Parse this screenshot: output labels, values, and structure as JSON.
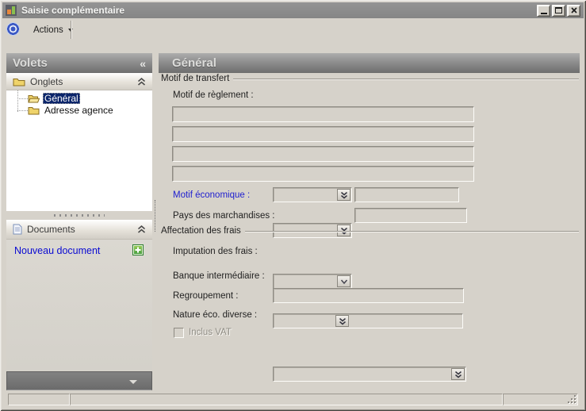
{
  "window": {
    "title": "Saisie complémentaire"
  },
  "toolbar": {
    "actions_label": "Actions"
  },
  "sidebar": {
    "header": "Volets",
    "collapse_glyph": "«",
    "onglets": {
      "label": "Onglets",
      "items": [
        {
          "label": "Général",
          "selected": true
        },
        {
          "label": "Adresse agence",
          "selected": false
        }
      ]
    },
    "documents": {
      "label": "Documents",
      "new_document_label": "Nouveau document"
    }
  },
  "main": {
    "header": "Général",
    "transfer_group": {
      "title": "Motif de transfert",
      "motif_reglement_label": "Motif de règlement :",
      "motif_values": [
        "",
        "",
        "",
        ""
      ],
      "motif_economique_label": "Motif économique :",
      "motif_economique_code": "",
      "motif_economique_value": "",
      "pays_label": "Pays des marchandises :",
      "pays_code": "",
      "pays_value": ""
    },
    "frais_group": {
      "title": "Affectation des frais",
      "imputation_label": "Imputation des frais :",
      "imputation_value": "",
      "banque_label": "Banque intermédiaire :",
      "banque_value": "",
      "regroupement_label": "Regroupement :",
      "regroupement_value": "",
      "nature_label": "Nature éco. diverse :",
      "nature_value": "",
      "inclus_vat_label": "Inclus VAT",
      "inclus_vat_checked": false
    }
  },
  "statusbar": {
    "left": "",
    "center": "",
    "right": ""
  },
  "colors": {
    "dialog_background": "#d6d2ca",
    "titlebar_gray": "#8b8b8b",
    "selection_blue": "#0a246a",
    "link_blue": "#0a0ad2",
    "blue_label": "#2020d0",
    "plus_green": "#3f9a3f",
    "folder_yellow": "#efd36a"
  }
}
